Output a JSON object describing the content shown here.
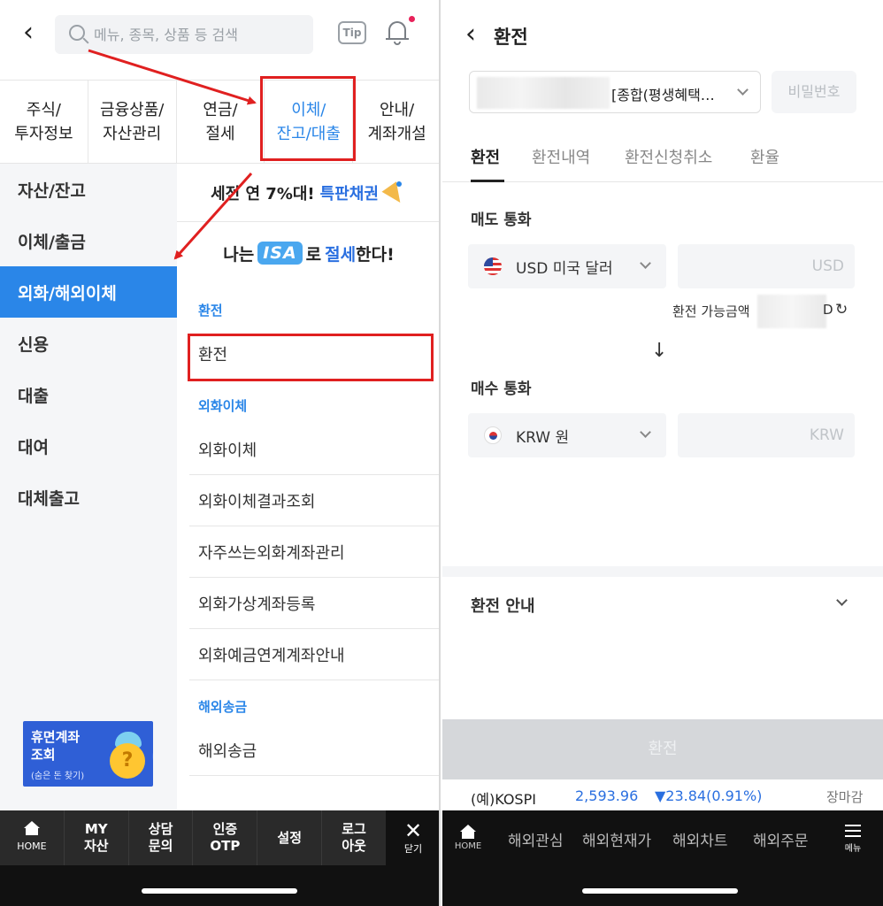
{
  "left": {
    "search": {
      "placeholder": "메뉴, 종목, 상품 등 검색"
    },
    "tip_label": "Tip",
    "categories": [
      {
        "label": "주식/\n투자정보"
      },
      {
        "label": "금융상품/\n자산관리"
      },
      {
        "label": "연금/\n절세"
      },
      {
        "label": "이체/\n잔고/대출"
      },
      {
        "label": "안내/\n계좌개설"
      }
    ],
    "left_menu": [
      "자산/잔고",
      "이체/출금",
      "외화/해외이체",
      "신용",
      "대출",
      "대여",
      "대체출고"
    ],
    "banner1": {
      "text": "세전 연 7%대!",
      "highlight": "특판채권"
    },
    "banner2": {
      "prefix": "나는",
      "isa": "ISA",
      "middle": "로",
      "highlight": "절세",
      "suffix": "한다!"
    },
    "sections": [
      {
        "label": "환전",
        "items": [
          "환전"
        ]
      },
      {
        "label": "외화이체",
        "items": [
          "외화이체",
          "외화이체결과조회",
          "자주쓰는외화계좌관리",
          "외화가상계좌등록",
          "외화예금연계계좌안내"
        ]
      },
      {
        "label": "해외송금",
        "items": [
          "해외송금"
        ]
      }
    ],
    "dormant": {
      "title": "휴면계좌\n조회",
      "sub": "(숨은 돈 찾기)",
      "q": "?"
    },
    "bottom_tabs": [
      {
        "label": "HOME"
      },
      {
        "label": "MY\n자산"
      },
      {
        "label": "상담\n문의"
      },
      {
        "label": "인증\nOTP"
      },
      {
        "label": "설정"
      },
      {
        "label": "로그\n아웃"
      }
    ],
    "close_label": "닫기"
  },
  "right": {
    "title": "환전",
    "account_text": "[종합(평생혜택…",
    "password_label": "비밀번호",
    "tabs": [
      "환전",
      "환전내역",
      "환전신청취소",
      "환율"
    ],
    "sell_label": "매도 통화",
    "sell_currency": "USD 미국 달러",
    "sell_placeholder": "USD",
    "available_label": "환전 가능금액",
    "available_suffix": "D",
    "buy_label": "매수 통화",
    "buy_currency": "KRW 원",
    "buy_placeholder": "KRW",
    "guide_label": "환전 안내",
    "exchange_button": "환전",
    "ticker": {
      "name": "(예)KOSPI",
      "value": "2,593.96",
      "change": "▼23.84(0.91%)",
      "status": "장마감"
    },
    "bottom_nav": {
      "home": "HOME",
      "items": [
        "해외관심",
        "해외현재가",
        "해외차트",
        "해외주문"
      ],
      "menu": "메뉴"
    }
  },
  "colors": {
    "accent": "#2a86e8",
    "annotation_red": "#e02020",
    "ticker_blue": "#2a6fe0"
  }
}
